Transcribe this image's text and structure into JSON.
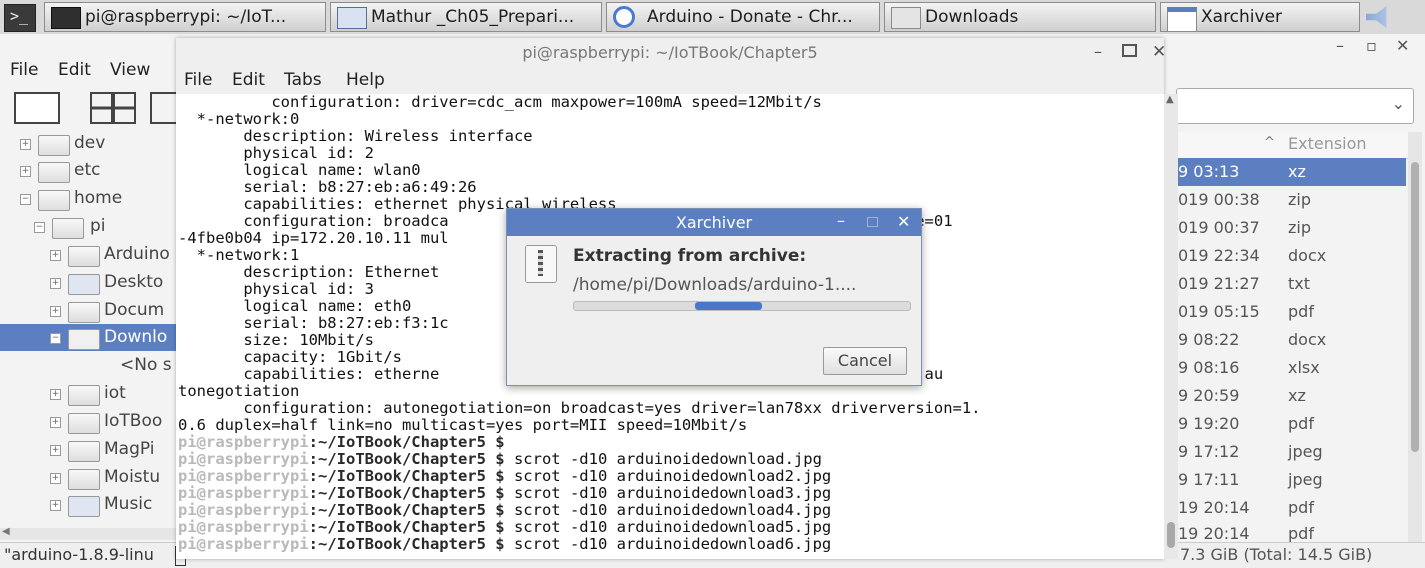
{
  "taskbar": {
    "items": [
      {
        "label": "pi@raspberrypi: ~/IoT..."
      },
      {
        "label": "Mathur _Ch05_Prepari..."
      },
      {
        "label": "Arduino - Donate - Chr..."
      },
      {
        "label": "Downloads"
      },
      {
        "label": "Xarchiver"
      }
    ]
  },
  "xarchiver": {
    "menu": {
      "file": "File",
      "edit": "Edit",
      "view": "View"
    },
    "tree": [
      {
        "label": "dev"
      },
      {
        "label": "etc"
      },
      {
        "label": "home"
      },
      {
        "label": "pi"
      },
      {
        "label": "Arduino"
      },
      {
        "label": "Deskto"
      },
      {
        "label": "Docum"
      },
      {
        "label": "Downlo"
      },
      {
        "label": "<No s"
      },
      {
        "label": "iot"
      },
      {
        "label": "IoTBoo"
      },
      {
        "label": "MagPi"
      },
      {
        "label": "Moistu"
      },
      {
        "label": "Music"
      }
    ],
    "column_extension": "Extension",
    "files": [
      {
        "date": "9 03:13",
        "ext": "xz"
      },
      {
        "date": "019 00:38",
        "ext": "zip"
      },
      {
        "date": "019 00:37",
        "ext": "zip"
      },
      {
        "date": "019 22:34",
        "ext": "docx"
      },
      {
        "date": "019 21:27",
        "ext": "txt"
      },
      {
        "date": "019 05:15",
        "ext": "pdf"
      },
      {
        "date": "9 08:22",
        "ext": "docx"
      },
      {
        "date": "9 08:16",
        "ext": "xlsx"
      },
      {
        "date": "9 20:59",
        "ext": "xz"
      },
      {
        "date": "9 19:20",
        "ext": "pdf"
      },
      {
        "date": "9 17:12",
        "ext": "jpeg"
      },
      {
        "date": "9 17:11",
        "ext": "jpeg"
      },
      {
        "date": "19 20:14",
        "ext": "pdf"
      },
      {
        "date": "19 20:14",
        "ext": "pdf"
      }
    ],
    "status_left": "\"arduino-1.8.9-linu",
    "status_right": "7.3 GiB (Total: 14.5 GiB)"
  },
  "terminal": {
    "title": "pi@raspberrypi: ~/IoTBook/Chapter5",
    "menu": {
      "file": "File",
      "edit": "Edit",
      "tabs": "Tabs",
      "help": "Help"
    },
    "lines": [
      "          configuration: driver=cdc_acm maxpower=100mA speed=12Mbit/s",
      "  *-network:0",
      "       description: Wireless interface",
      "       physical id: 2",
      "       logical name: wlan0",
      "       serial: b8:27:eb:a6:49:26",
      "       capabilities: ethernet physical wireless",
      "       configuration: broadca                                 =7.45.154 firmware=01",
      "-4fbe0b04 ip=172.20.10.11 mul",
      "  *-network:1",
      "       description: Ethernet",
      "       physical id: 3",
      "       logical name: eth0",
      "       serial: b8:27:eb:f3:1c",
      "       size: 10Mbit/s",
      "       capacity: 1Gbit/s",
      "       capabilities: etherne                                 100bt-fd 1000bt-fd au",
      "tonegotiation",
      "       configuration: autonegotiation=on broadcast=yes driver=lan78xx driverversion=1.",
      "0.6 duplex=half link=no multicast=yes port=MII speed=10Mbit/s"
    ],
    "prompt_user": "pi@raspberrypi",
    "prompt_path": ":~/IoTBook/Chapter5 $",
    "commands": [
      "",
      " scrot -d10 arduinoidedownload.jpg",
      " scrot -d10 arduinoidedownload2.jpg",
      " scrot -d10 arduinoidedownload3.jpg",
      " scrot -d10 arduinoidedownload4.jpg",
      " scrot -d10 arduinoidedownload5.jpg",
      " scrot -d10 arduinoidedownload6.jpg"
    ]
  },
  "dialog": {
    "title": "Xarchiver",
    "heading": "Extracting from archive:",
    "path": "/home/pi/Downloads/arduino-1....",
    "cancel": "Cancel",
    "progress_fraction": 0.45
  }
}
